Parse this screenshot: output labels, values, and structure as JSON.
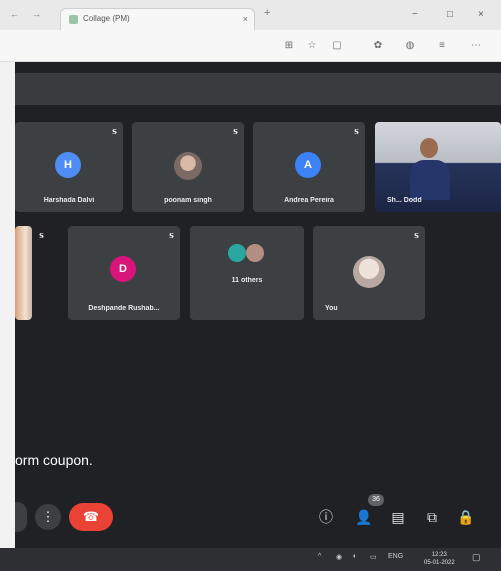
{
  "browser": {
    "tab_title": "Collage (PM)",
    "tab_close": "×",
    "tab_add": "+",
    "nav_back": "←",
    "nav_forward": "→",
    "window_controls": {
      "minimize": "−",
      "maximize": "□",
      "close": "×"
    },
    "toolbar_icons": [
      "extensions-icon",
      "favorite-icon",
      "tabs-icon",
      "collections-icon",
      "profile-icon",
      "share-icon",
      "more-icon"
    ]
  },
  "meet": {
    "participants_row1": [
      {
        "name": "Harshada Dalvi",
        "initial": "H",
        "avatar_color": "#4f8df5",
        "kind": "letter"
      },
      {
        "name": "poonam singh",
        "initial": "",
        "kind": "photo"
      },
      {
        "name": "Andrea Pereira",
        "initial": "A",
        "avatar_color": "#3b82f6",
        "kind": "letter"
      },
      {
        "name": "Sh... Dodd",
        "initial": "",
        "kind": "video"
      }
    ],
    "participants_row2": [
      {
        "name": "",
        "kind": "edge-video"
      },
      {
        "name": "Deshpande Rushab...",
        "initial": "D",
        "avatar_color": "#d9157b",
        "kind": "letter"
      },
      {
        "name": "11 others",
        "kind": "others"
      },
      {
        "name": "You",
        "kind": "self"
      }
    ],
    "mic_icon_label": "œ",
    "caption_text": "orm coupon.",
    "controls": {
      "end_call_glyph": "☎",
      "more_glyph": "⋮",
      "participants_badge": "36"
    }
  },
  "taskbar": {
    "tray_text": "^ 0 ENG",
    "time": "12:23",
    "date": "05-01-2022"
  },
  "colors": {
    "meet_bg": "#202124",
    "tile_bg": "#3c4043",
    "end_call_red": "#ea4335"
  }
}
